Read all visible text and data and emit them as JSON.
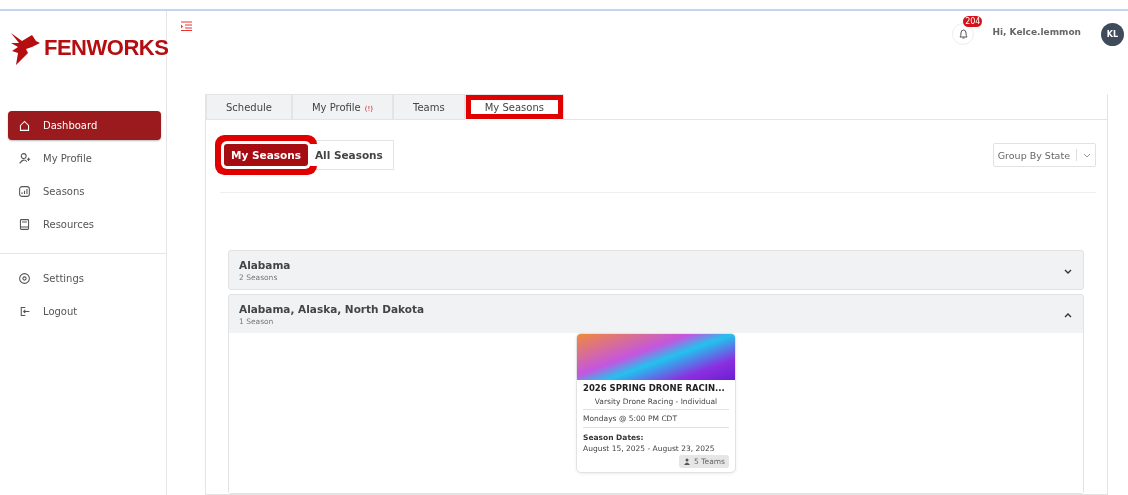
{
  "header": {
    "logo": "FENWORKS",
    "notifications": "204",
    "greeting": "Hi, Kelce.lemmon",
    "avatar": "KL"
  },
  "sidebar": {
    "items": [
      {
        "label": "Dashboard",
        "selected": true
      },
      {
        "label": "My Profile",
        "selected": false
      },
      {
        "label": "Seasons",
        "selected": false
      },
      {
        "label": "Resources",
        "selected": false
      }
    ],
    "footer_items": [
      {
        "label": "Settings",
        "selected": false
      },
      {
        "label": "Logout",
        "selected": false
      }
    ]
  },
  "tabs": [
    {
      "label": "Schedule",
      "selected": false,
      "highlighted": false
    },
    {
      "label": "My Profile",
      "alert": "(!)",
      "selected": false,
      "highlighted": false
    },
    {
      "label": "Teams",
      "selected": false,
      "highlighted": false
    },
    {
      "label": "My Seasons",
      "selected": true,
      "highlighted": true
    }
  ],
  "toggle": [
    {
      "label": "My Seasons",
      "selected": true,
      "highlighted": true
    },
    {
      "label": "All Seasons",
      "selected": false,
      "highlighted": false
    }
  ],
  "group_by": {
    "value": "Group By State"
  },
  "groups": [
    {
      "title": "Alabama",
      "count": "2 Seasons",
      "expanded": false
    },
    {
      "title": "Alabama, Alaska, North Dakota",
      "count": "1 Season",
      "expanded": true,
      "seasons": [
        {
          "title": "2026 SPRING DRONE RACIN...",
          "subtitle": "Varsity Drone Racing - Individual",
          "schedule": "Mondays @ 5:00 PM CDT",
          "dates_label": "Season Dates:",
          "dates": "August 15, 2025 - August 23, 2025",
          "teams": "5 Teams"
        }
      ]
    }
  ]
}
